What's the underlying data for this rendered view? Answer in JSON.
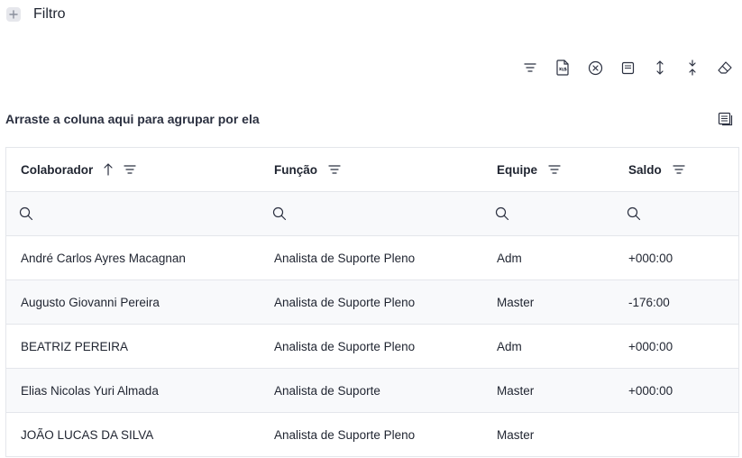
{
  "filter": {
    "title": "Filtro"
  },
  "toolbar": {
    "buttons": [
      {
        "icon": "filter-lines-icon"
      },
      {
        "icon": "export-xls-icon"
      },
      {
        "icon": "clear-filter-icon"
      },
      {
        "icon": "form-icon"
      },
      {
        "icon": "expand-rows-icon"
      },
      {
        "icon": "collapse-rows-icon"
      },
      {
        "icon": "eraser-icon"
      }
    ]
  },
  "group_panel": {
    "text": "Arraste a coluna aqui para agrupar por ela"
  },
  "grid": {
    "columns": [
      {
        "label": "Colaborador",
        "sorted": "ascending"
      },
      {
        "label": "Função"
      },
      {
        "label": "Equipe"
      },
      {
        "label": "Saldo"
      }
    ],
    "rows": [
      {
        "colaborador": "André Carlos Ayres Macagnan",
        "funcao": "Analista de Suporte Pleno",
        "equipe": "Adm",
        "saldo": "+000:00"
      },
      {
        "colaborador": "Augusto Giovanni Pereira",
        "funcao": "Analista de Suporte Pleno",
        "equipe": "Master",
        "saldo": "-176:00"
      },
      {
        "colaborador": "BEATRIZ PEREIRA",
        "funcao": "Analista de Suporte Pleno",
        "equipe": "Adm",
        "saldo": "+000:00"
      },
      {
        "colaborador": "Elias Nicolas Yuri Almada",
        "funcao": "Analista de Suporte",
        "equipe": "Master",
        "saldo": "+000:00"
      },
      {
        "colaborador": "JOÃO LUCAS DA SILVA",
        "funcao": "Analista de Suporte Pleno",
        "equipe": "Master",
        "saldo": ""
      }
    ]
  }
}
